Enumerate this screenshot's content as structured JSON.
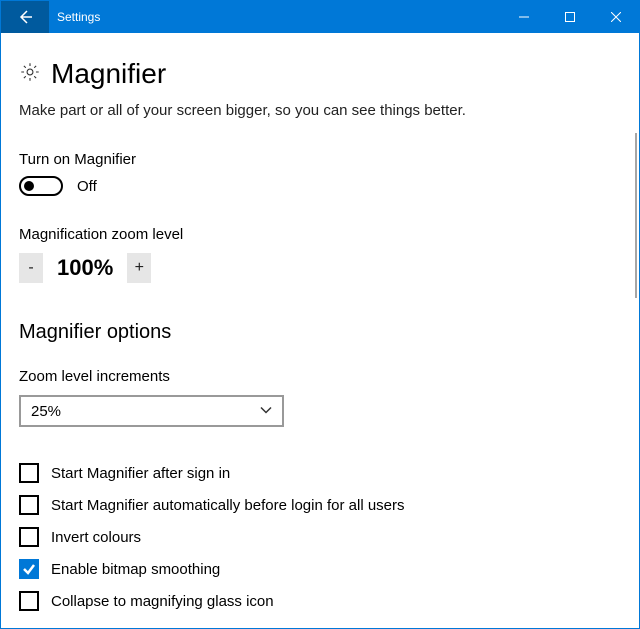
{
  "window": {
    "title": "Settings"
  },
  "page": {
    "heading": "Magnifier",
    "description": "Make part or all of your screen bigger, so you can see things better."
  },
  "toggle": {
    "label": "Turn on Magnifier",
    "state_text": "Off",
    "on": false
  },
  "zoom": {
    "label": "Magnification zoom level",
    "minus": "-",
    "plus": "+",
    "value": "100%"
  },
  "options": {
    "heading": "Magnifier options",
    "increments_label": "Zoom level increments",
    "increments_value": "25%",
    "checkboxes": [
      {
        "label": "Start Magnifier after sign in",
        "checked": false
      },
      {
        "label": "Start Magnifier automatically before login for all users",
        "checked": false
      },
      {
        "label": "Invert colours",
        "checked": false
      },
      {
        "label": "Enable bitmap smoothing",
        "checked": true
      },
      {
        "label": "Collapse to magnifying glass icon",
        "checked": false
      }
    ]
  }
}
